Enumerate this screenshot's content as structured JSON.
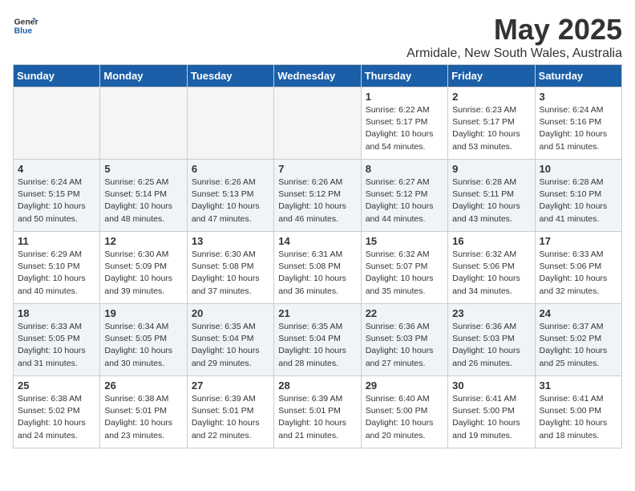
{
  "header": {
    "logo_line1": "General",
    "logo_line2": "Blue",
    "title": "May 2025",
    "subtitle": "Armidale, New South Wales, Australia"
  },
  "days_of_week": [
    "Sunday",
    "Monday",
    "Tuesday",
    "Wednesday",
    "Thursday",
    "Friday",
    "Saturday"
  ],
  "weeks": [
    [
      {
        "day": "",
        "info": ""
      },
      {
        "day": "",
        "info": ""
      },
      {
        "day": "",
        "info": ""
      },
      {
        "day": "",
        "info": ""
      },
      {
        "day": "1",
        "info": "Sunrise: 6:22 AM\nSunset: 5:17 PM\nDaylight: 10 hours\nand 54 minutes."
      },
      {
        "day": "2",
        "info": "Sunrise: 6:23 AM\nSunset: 5:17 PM\nDaylight: 10 hours\nand 53 minutes."
      },
      {
        "day": "3",
        "info": "Sunrise: 6:24 AM\nSunset: 5:16 PM\nDaylight: 10 hours\nand 51 minutes."
      }
    ],
    [
      {
        "day": "4",
        "info": "Sunrise: 6:24 AM\nSunset: 5:15 PM\nDaylight: 10 hours\nand 50 minutes."
      },
      {
        "day": "5",
        "info": "Sunrise: 6:25 AM\nSunset: 5:14 PM\nDaylight: 10 hours\nand 48 minutes."
      },
      {
        "day": "6",
        "info": "Sunrise: 6:26 AM\nSunset: 5:13 PM\nDaylight: 10 hours\nand 47 minutes."
      },
      {
        "day": "7",
        "info": "Sunrise: 6:26 AM\nSunset: 5:12 PM\nDaylight: 10 hours\nand 46 minutes."
      },
      {
        "day": "8",
        "info": "Sunrise: 6:27 AM\nSunset: 5:12 PM\nDaylight: 10 hours\nand 44 minutes."
      },
      {
        "day": "9",
        "info": "Sunrise: 6:28 AM\nSunset: 5:11 PM\nDaylight: 10 hours\nand 43 minutes."
      },
      {
        "day": "10",
        "info": "Sunrise: 6:28 AM\nSunset: 5:10 PM\nDaylight: 10 hours\nand 41 minutes."
      }
    ],
    [
      {
        "day": "11",
        "info": "Sunrise: 6:29 AM\nSunset: 5:10 PM\nDaylight: 10 hours\nand 40 minutes."
      },
      {
        "day": "12",
        "info": "Sunrise: 6:30 AM\nSunset: 5:09 PM\nDaylight: 10 hours\nand 39 minutes."
      },
      {
        "day": "13",
        "info": "Sunrise: 6:30 AM\nSunset: 5:08 PM\nDaylight: 10 hours\nand 37 minutes."
      },
      {
        "day": "14",
        "info": "Sunrise: 6:31 AM\nSunset: 5:08 PM\nDaylight: 10 hours\nand 36 minutes."
      },
      {
        "day": "15",
        "info": "Sunrise: 6:32 AM\nSunset: 5:07 PM\nDaylight: 10 hours\nand 35 minutes."
      },
      {
        "day": "16",
        "info": "Sunrise: 6:32 AM\nSunset: 5:06 PM\nDaylight: 10 hours\nand 34 minutes."
      },
      {
        "day": "17",
        "info": "Sunrise: 6:33 AM\nSunset: 5:06 PM\nDaylight: 10 hours\nand 32 minutes."
      }
    ],
    [
      {
        "day": "18",
        "info": "Sunrise: 6:33 AM\nSunset: 5:05 PM\nDaylight: 10 hours\nand 31 minutes."
      },
      {
        "day": "19",
        "info": "Sunrise: 6:34 AM\nSunset: 5:05 PM\nDaylight: 10 hours\nand 30 minutes."
      },
      {
        "day": "20",
        "info": "Sunrise: 6:35 AM\nSunset: 5:04 PM\nDaylight: 10 hours\nand 29 minutes."
      },
      {
        "day": "21",
        "info": "Sunrise: 6:35 AM\nSunset: 5:04 PM\nDaylight: 10 hours\nand 28 minutes."
      },
      {
        "day": "22",
        "info": "Sunrise: 6:36 AM\nSunset: 5:03 PM\nDaylight: 10 hours\nand 27 minutes."
      },
      {
        "day": "23",
        "info": "Sunrise: 6:36 AM\nSunset: 5:03 PM\nDaylight: 10 hours\nand 26 minutes."
      },
      {
        "day": "24",
        "info": "Sunrise: 6:37 AM\nSunset: 5:02 PM\nDaylight: 10 hours\nand 25 minutes."
      }
    ],
    [
      {
        "day": "25",
        "info": "Sunrise: 6:38 AM\nSunset: 5:02 PM\nDaylight: 10 hours\nand 24 minutes."
      },
      {
        "day": "26",
        "info": "Sunrise: 6:38 AM\nSunset: 5:01 PM\nDaylight: 10 hours\nand 23 minutes."
      },
      {
        "day": "27",
        "info": "Sunrise: 6:39 AM\nSunset: 5:01 PM\nDaylight: 10 hours\nand 22 minutes."
      },
      {
        "day": "28",
        "info": "Sunrise: 6:39 AM\nSunset: 5:01 PM\nDaylight: 10 hours\nand 21 minutes."
      },
      {
        "day": "29",
        "info": "Sunrise: 6:40 AM\nSunset: 5:00 PM\nDaylight: 10 hours\nand 20 minutes."
      },
      {
        "day": "30",
        "info": "Sunrise: 6:41 AM\nSunset: 5:00 PM\nDaylight: 10 hours\nand 19 minutes."
      },
      {
        "day": "31",
        "info": "Sunrise: 6:41 AM\nSunset: 5:00 PM\nDaylight: 10 hours\nand 18 minutes."
      }
    ]
  ]
}
